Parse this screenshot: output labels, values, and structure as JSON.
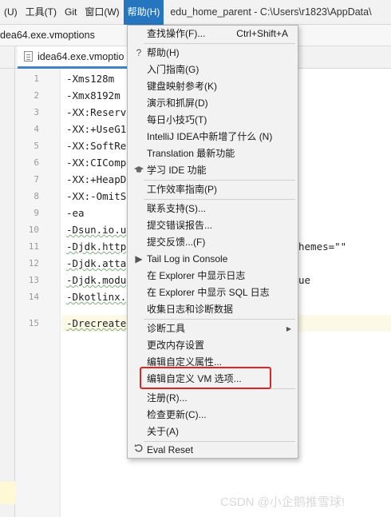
{
  "menubar": {
    "items": [
      "(U)",
      "工具(T)",
      "Git",
      "窗口(W)",
      "帮助(H)"
    ],
    "active_index": 4,
    "window_title": "edu_home_parent - C:\\Users\\r1823\\AppData\\"
  },
  "pathbar": {
    "text": "dea64.exe.vmoptions"
  },
  "editor": {
    "tab_label": "idea64.exe.vmoptio",
    "line_numbers": [
      "1",
      "2",
      "3",
      "4",
      "5",
      "6",
      "7",
      "8",
      "9",
      "10",
      "11",
      "12",
      "13",
      "14",
      "15"
    ],
    "lines": [
      "-Xms128m",
      "-Xmx8192m",
      "-XX:Reserv",
      "-XX:+UseG1",
      "-XX:SoftRe",
      "-XX:CIComp",
      "-XX:+HeapD",
      "-XX:-OmitS",
      "-ea",
      "-Dsun.io.u",
      "-Djdk.http",
      "-Djdk.atta",
      "-Djdk.modu",
      "-Dkotlinx.",
      "-Drecreate"
    ],
    "overflow_text": {
      "line11": "hemes=\"\"",
      "line13": "ue"
    },
    "current_line": 15
  },
  "help_menu": {
    "items": [
      {
        "label": "查找操作(F)...",
        "shortcut": "Ctrl+Shift+A"
      },
      {
        "label": "帮助(H)",
        "icon": "?"
      },
      {
        "label": "入门指南(G)"
      },
      {
        "label": "键盘映射参考(K)"
      },
      {
        "label": "演示和抓屏(D)"
      },
      {
        "label": "每日小技巧(T)"
      },
      {
        "label": "IntelliJ IDEA中新增了什么 (N)"
      },
      {
        "label": "Translation 最新功能"
      },
      {
        "label": "学习 IDE 功能",
        "icon": "graduation-cap"
      },
      {
        "label": "工作效率指南(P)"
      },
      {
        "label": "联系支持(S)..."
      },
      {
        "label": "提交错误报告..."
      },
      {
        "label": "提交反馈...(F)"
      },
      {
        "label": "Tail Log in Console",
        "icon": "▶"
      },
      {
        "label": "在 Explorer 中显示日志"
      },
      {
        "label": "在 Explorer 中显示 SQL 日志"
      },
      {
        "label": "收集日志和诊断数据"
      },
      {
        "label": "诊断工具",
        "submenu": true
      },
      {
        "label": "更改内存设置"
      },
      {
        "label": "编辑自定义属性..."
      },
      {
        "label": "编辑自定义 VM 选项..."
      },
      {
        "label": "注册(R)..."
      },
      {
        "label": "检查更新(C)..."
      },
      {
        "label": "关于(A)"
      },
      {
        "label": "Eval Reset",
        "icon": "reset"
      }
    ],
    "highlighted_item": "编辑自定义 VM 选项...",
    "highlight_color": "#e02424",
    "accent_color": "#2675bf"
  },
  "watermark": "CSDN @小企鹅推雪球!"
}
